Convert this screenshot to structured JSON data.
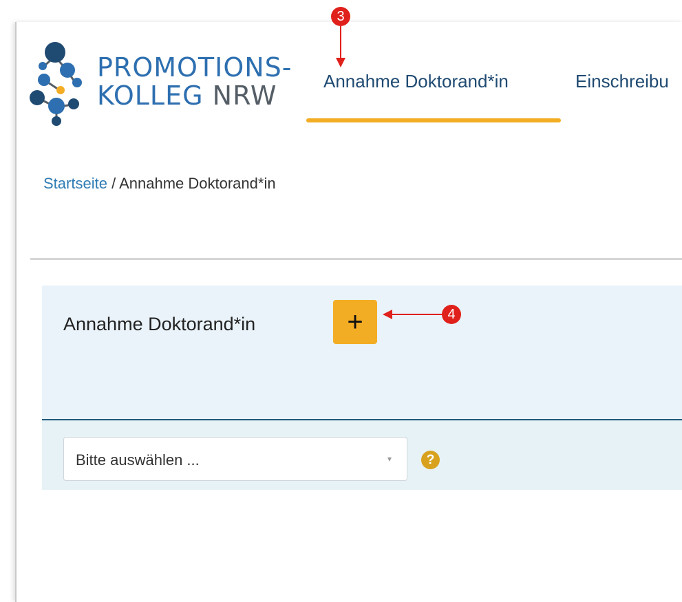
{
  "brand": {
    "line1": "PROMOTIONS-",
    "line2_a": "KOLLEG ",
    "line2_b": "NRW",
    "logo_icon": "promotionskolleg-molecule-logo-icon"
  },
  "nav": {
    "active_label": "Annahme Doktorand*in",
    "next_label": "Einschreibu",
    "accent_color": "#f3ad25"
  },
  "breadcrumb": {
    "home": "Startseite",
    "separator": "/",
    "current": "Annahme Doktorand*in"
  },
  "panel": {
    "title": "Annahme Doktorand*in",
    "add_label": "+"
  },
  "filter": {
    "select_value": "Bitte auswählen ...",
    "caret_icon": "▾",
    "help_label": "?"
  },
  "annotations": {
    "marker_3": "3",
    "marker_4": "4",
    "color": "#e0201b"
  }
}
